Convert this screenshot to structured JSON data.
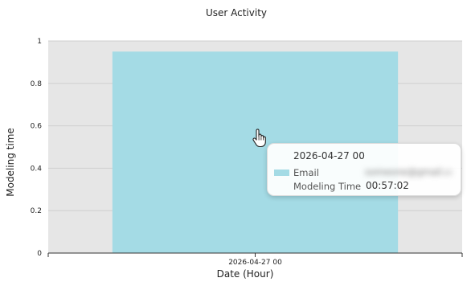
{
  "chart_data": {
    "type": "bar",
    "title": "User Activity",
    "xlabel": "Date (Hour)",
    "ylabel": "Modeling time",
    "categories": [
      "2026-04-27 00"
    ],
    "series": [
      {
        "values": [
          0.95
        ]
      }
    ],
    "ylim": [
      0,
      1
    ],
    "yticks": [
      0,
      0.2,
      0.4,
      0.6,
      0.8,
      1
    ],
    "grid": true,
    "colors": {
      "bar": "#a4dbe5",
      "plot_background": "#e6e6e6",
      "gridline": "#cfcfcf"
    }
  },
  "tooltip": {
    "title": "2026-04-27 00",
    "email_label": "Email",
    "email_value": "someone@gmail.com",
    "time_label": "Modeling Time",
    "time_value": "00:57:02",
    "swatch_color": "#a4dbe5"
  },
  "cursor_icon": "hand-pointer-icon"
}
